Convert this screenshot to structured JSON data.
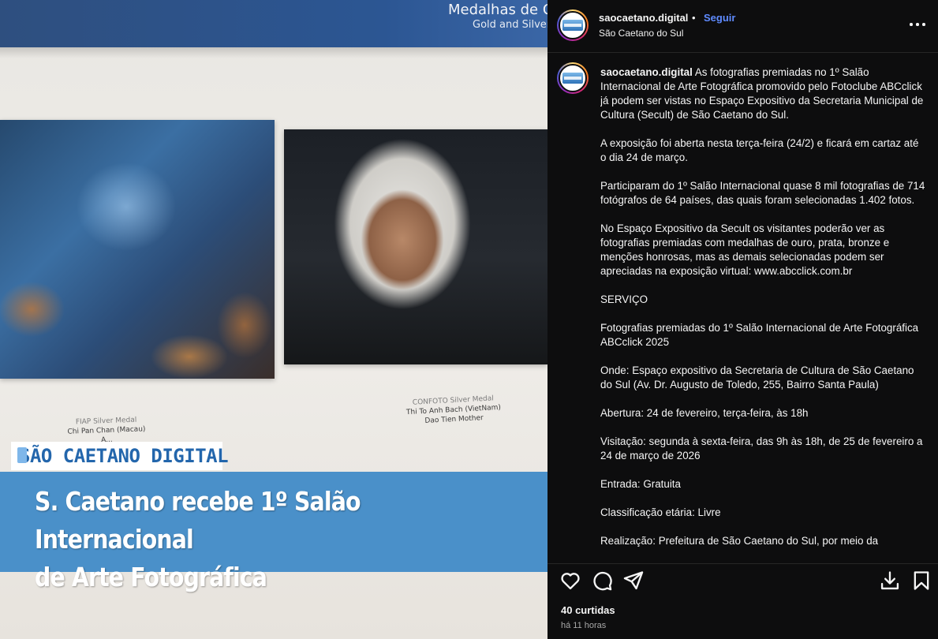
{
  "post_image": {
    "banner_title": "Medalhas de Ou",
    "banner_subtitle": "Gold and Silver",
    "caption_left": {
      "medal": "FIAP Silver Medal",
      "author": "Chi Pan Chan (Macau)",
      "title": "A..."
    },
    "caption_right": {
      "medal": "CONFOTO Silver Medal",
      "author": "Thi To Anh Bach (VietNam)",
      "title": "Dao Tien Mother"
    },
    "brand": "SÃO CAETANO DIGITAL",
    "headline_line1": "S. Caetano recebe 1º Salão Internacional",
    "headline_line2": "de Arte Fotográfica"
  },
  "header": {
    "username": "saocaetano.digital",
    "separator": "•",
    "follow_label": "Seguir",
    "location": "São Caetano do Sul"
  },
  "caption": {
    "username": "saocaetano.digital",
    "intro": "As fotografias premiadas no 1º Salão Internacional de Arte Fotográfica promovido pelo Fotoclube ABCclick já podem ser vistas no Espaço Expositivo da Secretaria Municipal de Cultura (Secult) de São Caetano do Sul.",
    "paragraphs": [
      "A exposição foi aberta nesta terça-feira (24/2) e ficará em cartaz até o dia 24 de março.",
      "Participaram do 1º Salão Internacional quase 8 mil fotografias de 714 fotógrafos de 64 países, das quais foram selecionadas 1.402 fotos.",
      "No Espaço Expositivo da Secult os visitantes poderão ver as fotografias premiadas com medalhas de ouro, prata, bronze e menções honrosas, mas as demais selecionadas podem ser apreciadas na exposição virtual: www.abcclick.com.br",
      "SERVIÇO",
      "Fotografias premiadas do 1º Salão Internacional de Arte Fotográfica ABCclick 2025",
      "Onde: Espaço expositivo da Secretaria de Cultura de São Caetano do Sul (Av. Dr. Augusto de Toledo, 255, Bairro Santa Paula)",
      "Abertura: 24 de fevereiro, terça-feira, às 18h",
      "Visitação: segunda à sexta-feira, das 9h às 18h, de 25 de fevereiro a 24 de março de 2026",
      "Entrada: Gratuita",
      "Classificação etária: Livre",
      "Realização: Prefeitura de São Caetano do Sul, por meio da"
    ]
  },
  "actions": {
    "icons": [
      "heart-icon",
      "comment-icon",
      "share-icon",
      "download-icon",
      "bookmark-icon"
    ]
  },
  "likes": "40 curtidas",
  "timestamp": "há 11 horas",
  "colors": {
    "panel_bg": "#0d0d0e",
    "follow": "#5f8bff",
    "headline_bg": "#4a90c9",
    "brand_blue": "#2366ac"
  }
}
